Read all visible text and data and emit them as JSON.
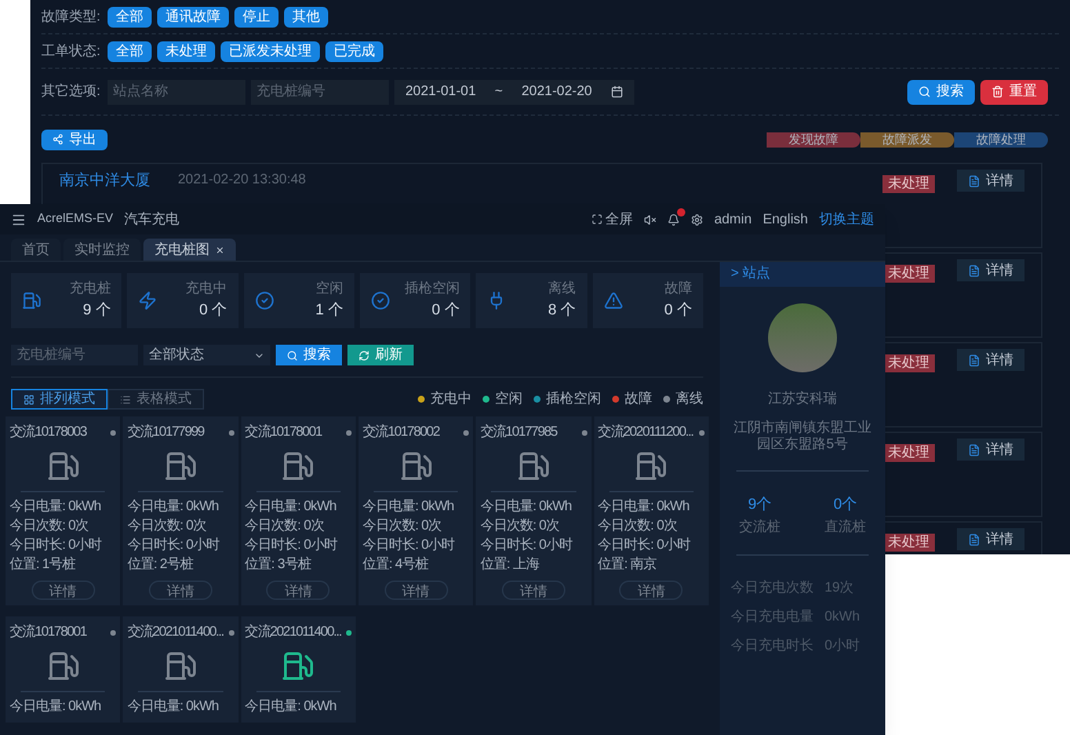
{
  "fault_window": {
    "filters": [
      {
        "label": "故障类型:",
        "options": [
          "全部",
          "通讯故障",
          "停止",
          "其他"
        ]
      },
      {
        "label": "工单状态:",
        "options": [
          "全部",
          "未处理",
          "已派发未处理",
          "已完成"
        ]
      }
    ],
    "other_options": {
      "label": "其它选项:",
      "station_placeholder": "站点名称",
      "pile_placeholder": "充电桩编号",
      "date_from": "2021-01-01",
      "date_separator": "~",
      "date_to": "2021-02-20"
    },
    "search_button": "搜索",
    "reset_button": "重置",
    "export_button": "导出",
    "steps": [
      {
        "label": "发现故障",
        "color": "#7a2e3c"
      },
      {
        "label": "故障派发",
        "color": "#7a5a2c"
      },
      {
        "label": "故障处理",
        "color": "#1c4576"
      }
    ],
    "rows": [
      {
        "name": "南京中洋大厦",
        "time": "2021-02-20 13:30:48",
        "status": "未处理",
        "button": "详情"
      },
      {
        "status": "未处理",
        "button": "详情"
      },
      {
        "status": "未处理",
        "button": "详情"
      },
      {
        "status": "未处理",
        "button": "详情"
      },
      {
        "status": "未处理",
        "button": "详情"
      }
    ]
  },
  "monitor_window": {
    "app_title": "AcrelEMS-EV",
    "module_title": "汽车充电",
    "header_actions": {
      "fullscreen": "全屏",
      "notifications_unread": true,
      "user": "admin",
      "language": "English",
      "theme": "切换主题"
    },
    "tabs": [
      {
        "label": "首页",
        "selected": false
      },
      {
        "label": "实时监控",
        "selected": false
      },
      {
        "label": "充电桩图",
        "selected": true
      }
    ],
    "stats": [
      {
        "kind": "pile",
        "label": "充电桩",
        "value": "9",
        "unit": "个"
      },
      {
        "kind": "bolt",
        "label": "充电中",
        "value": "0",
        "unit": "个"
      },
      {
        "kind": "check",
        "label": "空闲",
        "value": "1",
        "unit": "个"
      },
      {
        "kind": "check",
        "label": "插枪空闲",
        "value": "0",
        "unit": "个"
      },
      {
        "kind": "plug",
        "label": "离线",
        "value": "8",
        "unit": "个"
      },
      {
        "kind": "warning",
        "label": "故障",
        "value": "0",
        "unit": "个"
      }
    ],
    "search": {
      "placeholder": "充电桩编号",
      "status_select": "全部状态",
      "search_button": "搜索",
      "refresh_button": "刷新"
    },
    "view_modes": [
      {
        "label": "排列模式",
        "selected": true
      },
      {
        "label": "表格模式",
        "selected": false
      }
    ],
    "legend": [
      {
        "label": "充电中",
        "color": "#c9a21a"
      },
      {
        "label": "空闲",
        "color": "#1fb98d"
      },
      {
        "label": "插枪空闲",
        "color": "#1a8fa3"
      },
      {
        "label": "故障",
        "color": "#d33a2c"
      },
      {
        "label": "离线",
        "color": "#7d8590"
      }
    ],
    "chargers": [
      {
        "title": "交流10178003",
        "color": "#7d8590",
        "lines": [
          "今日电量: 0kWh",
          "今日次数: 0次",
          "今日时长: 0小时",
          "位置: 1号桩"
        ],
        "button": "详情"
      },
      {
        "title": "交流10177999",
        "color": "#7d8590",
        "lines": [
          "今日电量: 0kWh",
          "今日次数: 0次",
          "今日时长: 0小时",
          "位置: 2号桩"
        ],
        "button": "详情"
      },
      {
        "title": "交流10178001",
        "color": "#7d8590",
        "lines": [
          "今日电量: 0kWh",
          "今日次数: 0次",
          "今日时长: 0小时",
          "位置: 3号桩"
        ],
        "button": "详情"
      },
      {
        "title": "交流10178002",
        "color": "#7d8590",
        "lines": [
          "今日电量: 0kWh",
          "今日次数: 0次",
          "今日时长: 0小时",
          "位置: 4号桩"
        ],
        "button": "详情"
      },
      {
        "title": "交流10177985",
        "color": "#7d8590",
        "lines": [
          "今日电量: 0kWh",
          "今日次数: 0次",
          "今日时长: 0小时",
          "位置: 上海"
        ],
        "button": "详情"
      },
      {
        "title": "交流2020111200...",
        "color": "#7d8590",
        "lines": [
          "今日电量: 0kWh",
          "今日次数: 0次",
          "今日时长: 0小时",
          "位置: 南京"
        ],
        "button": "详情"
      },
      {
        "title": "交流10178001",
        "color": "#7d8590",
        "lines": [
          "今日电量: 0kWh"
        ]
      },
      {
        "title": "交流2021011400...",
        "color": "#7d8590",
        "lines": [
          "今日电量: 0kWh"
        ]
      },
      {
        "title": "交流2021011400...",
        "color": "#1fb98d",
        "lines": [
          "今日电量: 0kWh"
        ]
      }
    ],
    "site_panel": {
      "header": "> 站点",
      "name": "江苏安科瑞",
      "address": "江阴市南闸镇东盟工业园区东盟路5号",
      "counts": [
        {
          "value": "9",
          "unit": "个",
          "label": "交流桩"
        },
        {
          "value": "0",
          "unit": "个",
          "label": "直流桩"
        }
      ],
      "today": [
        {
          "label": "今日充电次数",
          "value": "19次"
        },
        {
          "label": "今日充电电量",
          "value": "0kWh"
        },
        {
          "label": "今日充电时长",
          "value": "0小时"
        }
      ]
    }
  }
}
